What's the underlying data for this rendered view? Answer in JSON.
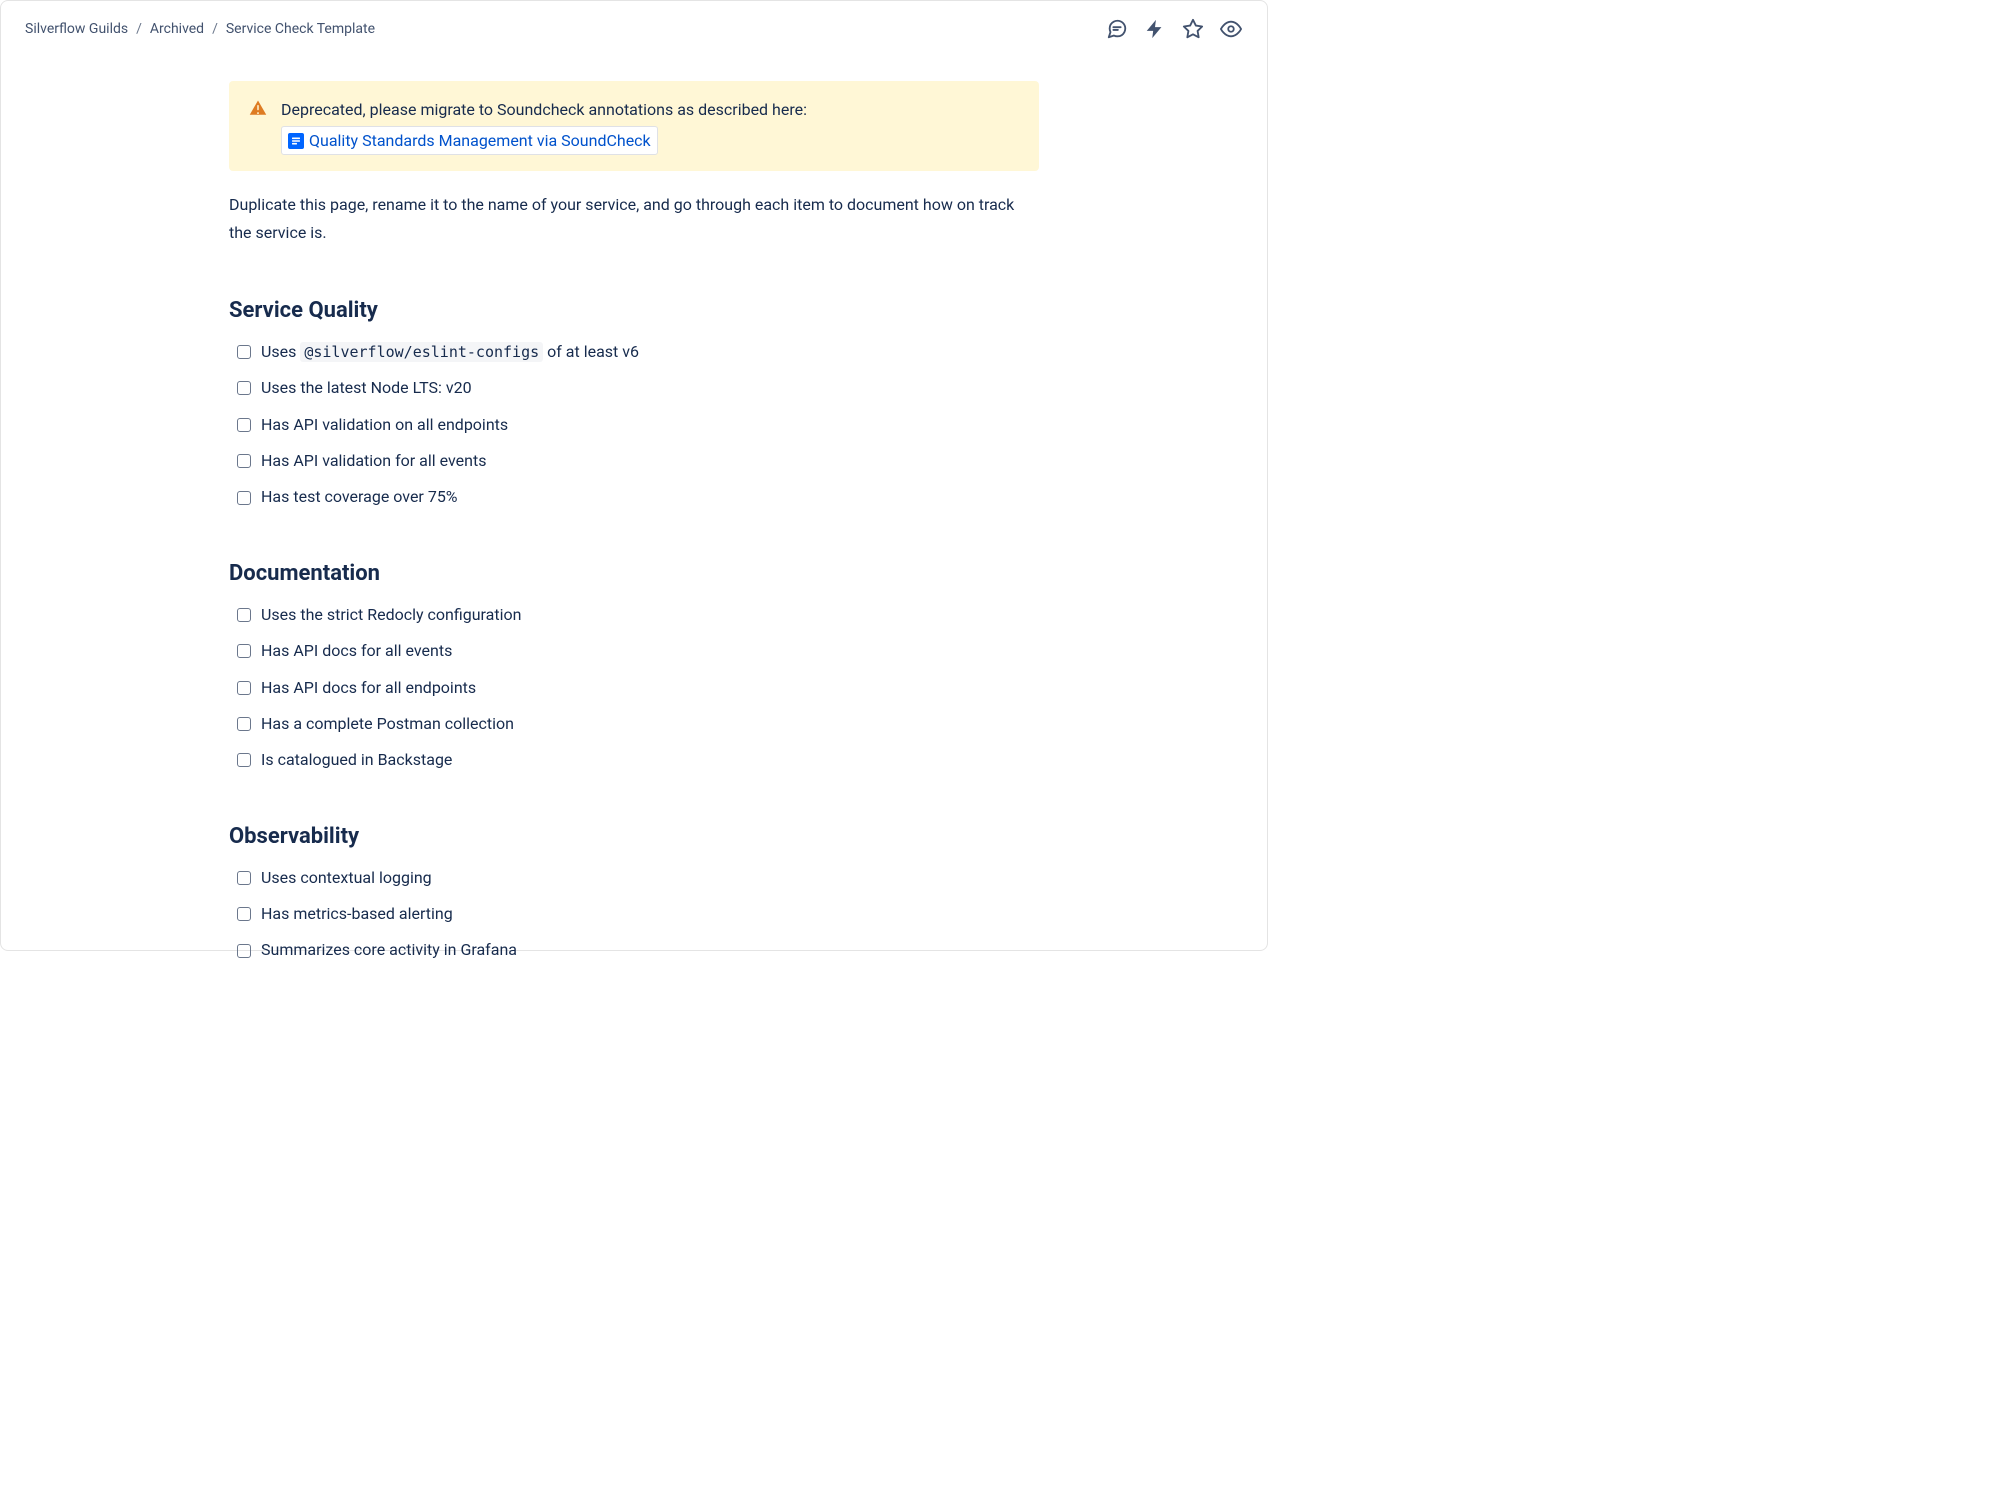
{
  "breadcrumb": {
    "root": "Silverflow Guilds",
    "archived": "Archived",
    "page": "Service Check Template"
  },
  "banner": {
    "text_before": "Deprecated, please migrate to Soundcheck annotations as described here: ",
    "chip_label": "Quality Standards Management via SoundCheck"
  },
  "intro": "Duplicate this page, rename it to the name of your service, and go through each item to document how on track the service is.",
  "sections": {
    "service_quality": {
      "heading": "Service Quality",
      "items": {
        "eslint_prefix": "Uses ",
        "eslint_code": "@silverflow/eslint-configs",
        "eslint_suffix": " of at least v6",
        "node": "Uses the latest Node LTS: v20",
        "api_endpoints": "Has API validation on all endpoints",
        "api_events": "Has API validation for all events",
        "coverage": "Has test coverage over 75%"
      }
    },
    "documentation": {
      "heading": "Documentation",
      "items": {
        "redocly": "Uses the strict Redocly configuration",
        "docs_events": "Has API docs for all events",
        "docs_endpoints": "Has API docs for all endpoints",
        "postman": "Has a complete Postman collection",
        "backstage": "Is catalogued in Backstage"
      }
    },
    "observability": {
      "heading": "Observability",
      "items": {
        "logging": "Uses contextual logging",
        "alerting": "Has metrics-based alerting",
        "grafana": "Summarizes core activity in Grafana"
      }
    }
  }
}
